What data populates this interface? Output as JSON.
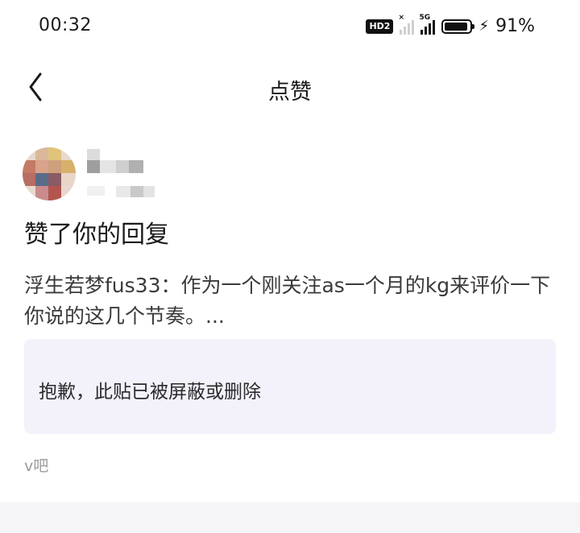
{
  "status": {
    "time": "00:32",
    "hd_label": "HD2",
    "net_label": "5G",
    "battery_level": 0.91,
    "battery_pct": "91%"
  },
  "nav": {
    "title": "点赞"
  },
  "notification": {
    "headline": "赞了你的回复",
    "quote": "浮生若梦fus33：作为一个刚关注as一个月的kg来评价一下你说的这几个节奏。...",
    "notice": "抱歉，此贴已被屏蔽或删除",
    "forum": "v吧"
  }
}
